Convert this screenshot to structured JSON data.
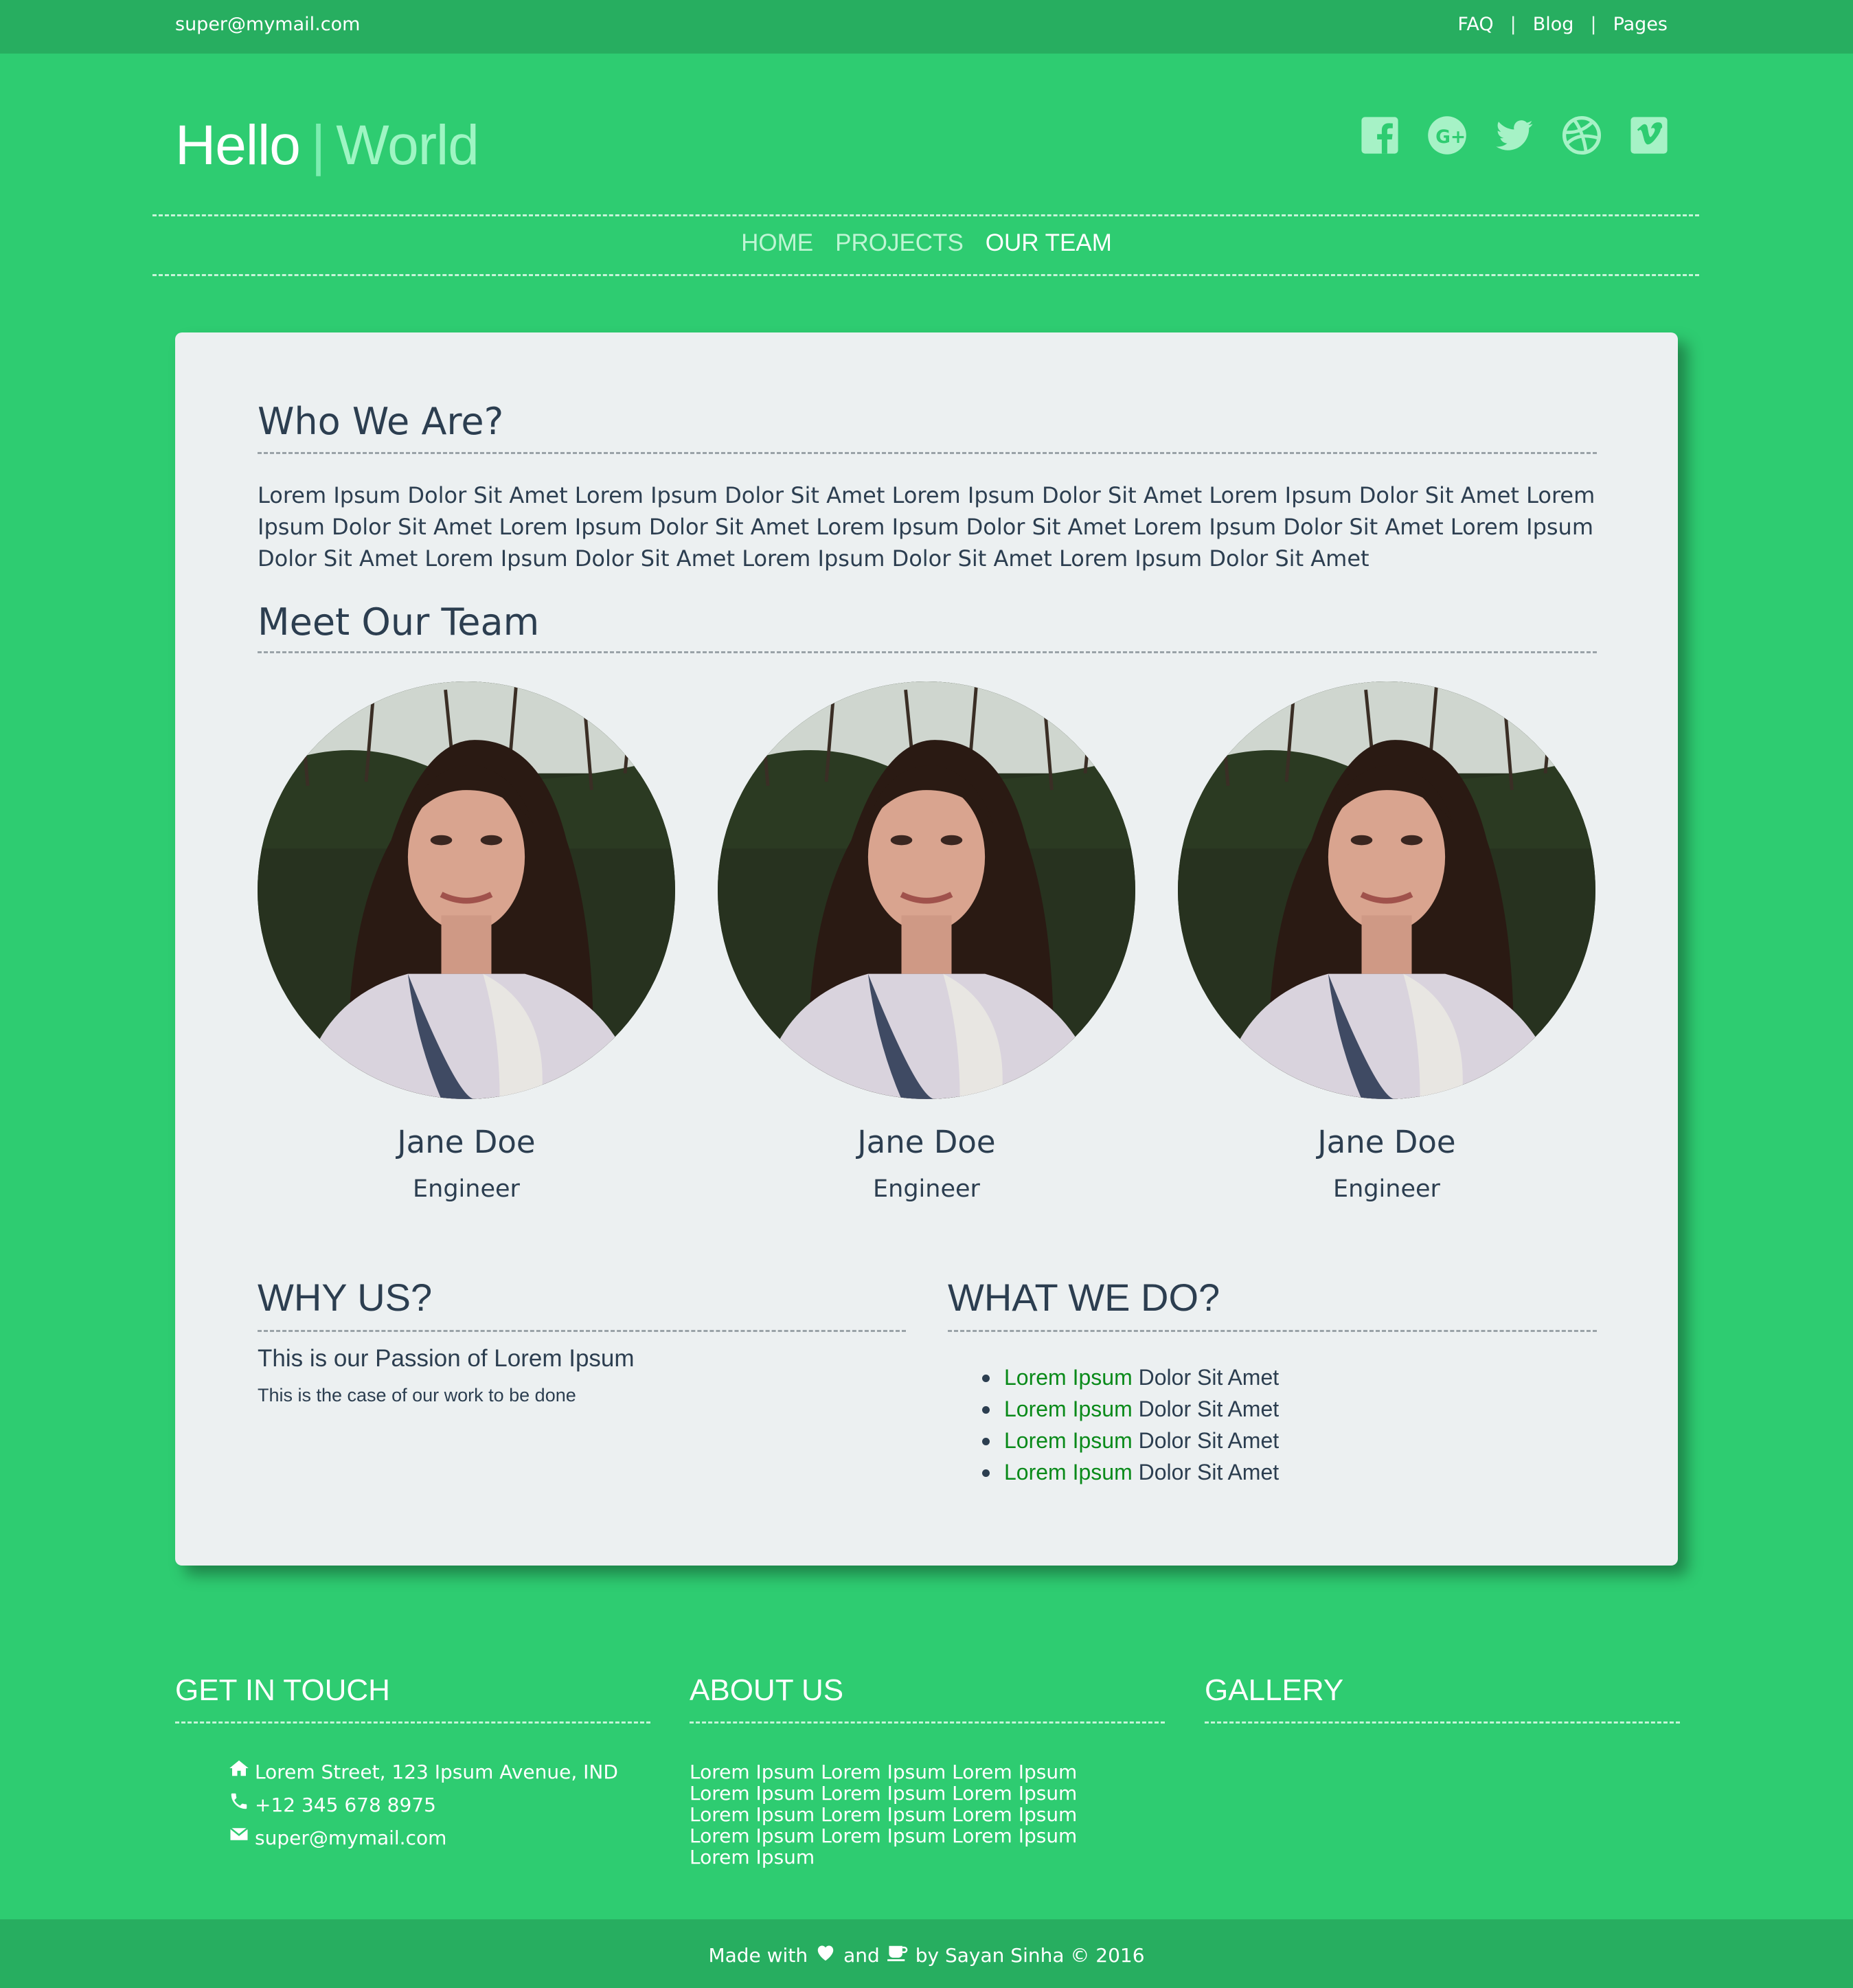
{
  "topbar": {
    "email": "super@mymail.com",
    "links": [
      "FAQ",
      "Blog",
      "Pages"
    ],
    "separator": "|"
  },
  "brand": {
    "hello": "Hello",
    "bar": "|",
    "world": "World"
  },
  "social_icons": [
    "facebook-icon",
    "google-plus-icon",
    "twitter-icon",
    "dribbble-icon",
    "vimeo-icon"
  ],
  "nav": {
    "items": [
      "HOME",
      "PROJECTS",
      "OUR TEAM"
    ],
    "active": "OUR TEAM"
  },
  "who": {
    "title": "Who We Are?",
    "text": "Lorem Ipsum Dolor Sit Amet Lorem Ipsum Dolor Sit Amet Lorem Ipsum Dolor Sit Amet Lorem Ipsum Dolor Sit Amet Lorem Ipsum Dolor Sit Amet Lorem Ipsum Dolor Sit Amet Lorem Ipsum Dolor Sit Amet Lorem Ipsum Dolor Sit Amet Lorem Ipsum Dolor Sit Amet Lorem Ipsum Dolor Sit Amet Lorem Ipsum Dolor Sit Amet Lorem Ipsum Dolor Sit Amet"
  },
  "team": {
    "title": "Meet Our Team",
    "members": [
      {
        "name": "Jane Doe",
        "role": "Engineer"
      },
      {
        "name": "Jane Doe",
        "role": "Engineer"
      },
      {
        "name": "Jane Doe",
        "role": "Engineer"
      }
    ]
  },
  "why": {
    "title": "WHY US?",
    "subtitle": "This is our Passion of Lorem Ipsum",
    "text": "This is the case of our work to be done"
  },
  "what": {
    "title": "WHAT WE DO?",
    "items": [
      {
        "highlight": "Lorem Ipsum",
        "rest": "Dolor Sit Amet"
      },
      {
        "highlight": "Lorem Ipsum",
        "rest": "Dolor Sit Amet"
      },
      {
        "highlight": "Lorem Ipsum",
        "rest": "Dolor Sit Amet"
      },
      {
        "highlight": "Lorem Ipsum",
        "rest": "Dolor Sit Amet"
      }
    ]
  },
  "footer": {
    "get_in_touch": {
      "title": "GET IN TOUCH",
      "address": "Lorem Street, 123 Ipsum Avenue, IND",
      "phone": "+12 345 678 8975",
      "email": "super@mymail.com"
    },
    "about": {
      "title": "ABOUT US",
      "text": "Lorem Ipsum Lorem Ipsum Lorem Ipsum Lorem Ipsum Lorem Ipsum Lorem Ipsum Lorem Ipsum Lorem Ipsum Lorem Ipsum Lorem Ipsum Lorem Ipsum Lorem Ipsum Lorem Ipsum"
    },
    "gallery": {
      "title": "GALLERY"
    },
    "credit": {
      "made_with": "Made with",
      "and": "and",
      "by": "by Sayan Sinha © 2016"
    }
  },
  "colors": {
    "primary": "#2ecc71",
    "dark_green": "#27ae60",
    "card_bg": "#ecf0f1",
    "text": "#2c3e50",
    "highlight": "#0a8a1a"
  }
}
